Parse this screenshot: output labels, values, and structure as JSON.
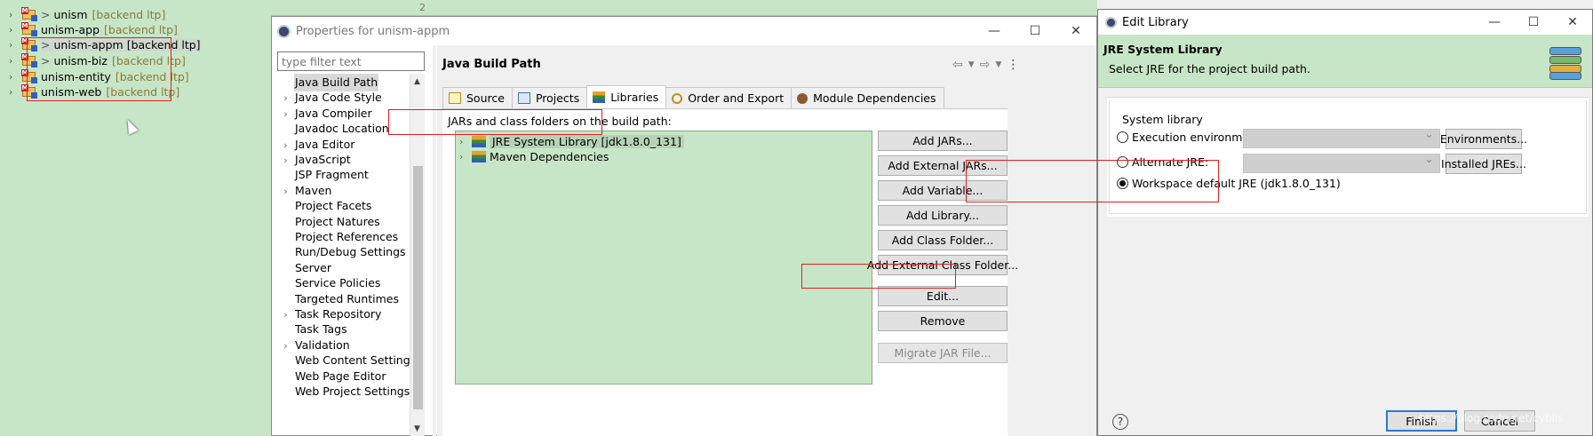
{
  "explorer": {
    "projects": [
      {
        "prefix": ">",
        "name": "unism",
        "tag": "[backend ltp]"
      },
      {
        "prefix": "",
        "name": "unism-app",
        "tag": "[backend ltp]"
      },
      {
        "prefix": ">",
        "name": "unism-appm",
        "tag": "[backend ltp]"
      },
      {
        "prefix": ">",
        "name": "unism-biz",
        "tag": "[backend ltp]"
      },
      {
        "prefix": "",
        "name": "unism-entity",
        "tag": "[backend ltp]"
      },
      {
        "prefix": "",
        "name": "unism-web",
        "tag": "[backend ltp]"
      }
    ]
  },
  "editor": {
    "line_number": "2"
  },
  "properties": {
    "title": "Properties for unism-appm",
    "filter_placeholder": "type filter text",
    "nav_items": [
      {
        "label": "Java Build Path",
        "expandable": false
      },
      {
        "label": "Java Code Style",
        "expandable": true
      },
      {
        "label": "Java Compiler",
        "expandable": true
      },
      {
        "label": "Javadoc Location",
        "expandable": false
      },
      {
        "label": "Java Editor",
        "expandable": true
      },
      {
        "label": "JavaScript",
        "expandable": true
      },
      {
        "label": "JSP Fragment",
        "expandable": false
      },
      {
        "label": "Maven",
        "expandable": true
      },
      {
        "label": "Project Facets",
        "expandable": false
      },
      {
        "label": "Project Natures",
        "expandable": false
      },
      {
        "label": "Project References",
        "expandable": false
      },
      {
        "label": "Run/Debug Settings",
        "expandable": false
      },
      {
        "label": "Server",
        "expandable": false
      },
      {
        "label": "Service Policies",
        "expandable": false
      },
      {
        "label": "Targeted Runtimes",
        "expandable": false
      },
      {
        "label": "Task Repository",
        "expandable": true
      },
      {
        "label": "Task Tags",
        "expandable": false
      },
      {
        "label": "Validation",
        "expandable": true
      },
      {
        "label": "Web Content Settings",
        "expandable": false
      },
      {
        "label": "Web Page Editor",
        "expandable": false
      },
      {
        "label": "Web Project Settings",
        "expandable": false
      }
    ],
    "page_title": "Java Build Path",
    "tabs": [
      "Source",
      "Projects",
      "Libraries",
      "Order and Export",
      "Module Dependencies"
    ],
    "jars_label": "JARs and class folders on the build path:",
    "libraries": [
      "JRE System Library [jdk1.8.0_131]",
      "Maven Dependencies"
    ],
    "buttons": {
      "add_jars": "Add JARs...",
      "add_external_jars": "Add External JARs...",
      "add_variable": "Add Variable...",
      "add_library": "Add Library...",
      "add_class_folder": "Add Class Folder...",
      "add_external_class_folder": "Add External Class Folder...",
      "edit": "Edit...",
      "remove": "Remove",
      "migrate_jar": "Migrate JAR File..."
    }
  },
  "edit_library": {
    "title": "Edit Library",
    "header_title": "JRE System Library",
    "header_desc": "Select JRE for the project build path.",
    "group_label": "System library",
    "execution_env_label": "Execution environment:",
    "alternate_jre_label": "Alternate JRE:",
    "workspace_default_label": "Workspace default JRE (jdk1.8.0_131)",
    "environments_button": "Environments...",
    "installed_jres_button": "Installed JREs...",
    "finish_button": "Finish",
    "cancel_button": "Cancel"
  },
  "watermark": "https://blog.csdn.net/cyblis",
  "colors": {
    "eclipse_green": "#c7e6c7",
    "highlight_red": "#e02020",
    "default_button_blue": "#2a7ad2"
  }
}
